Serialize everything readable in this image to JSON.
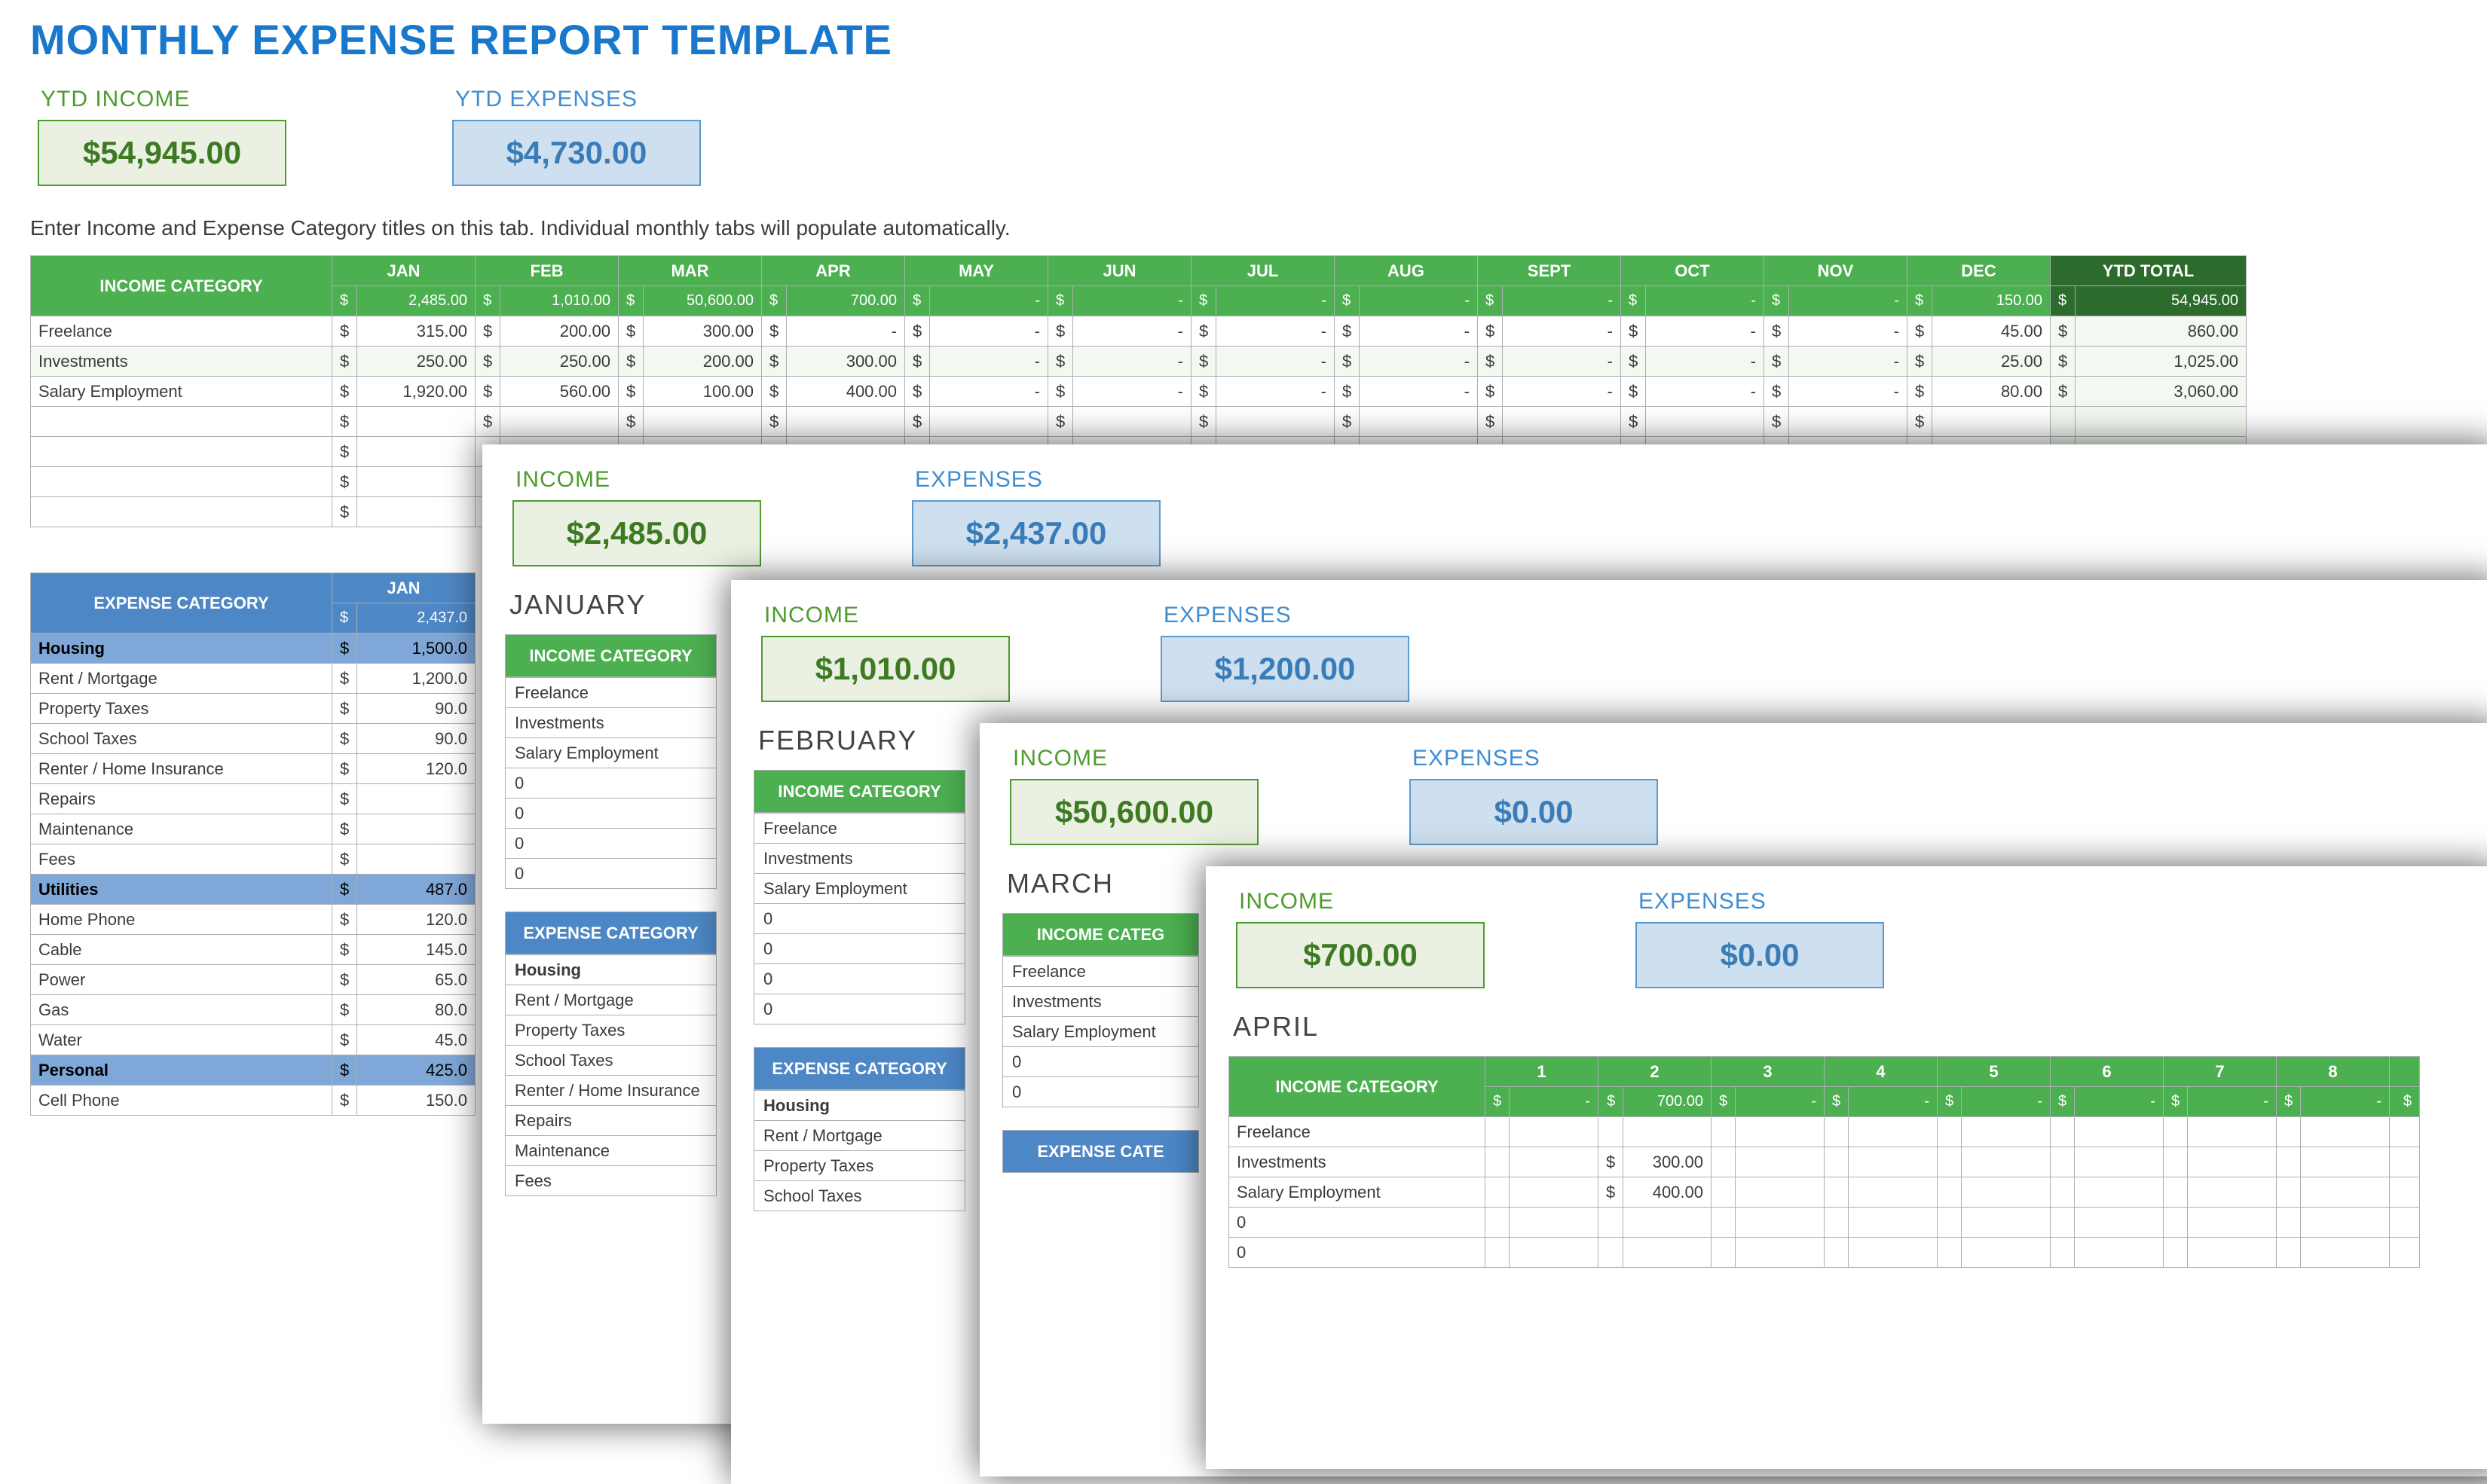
{
  "title": "MONTHLY EXPENSE REPORT TEMPLATE",
  "ytd": {
    "income_label": "YTD INCOME",
    "income_value": "$54,945.00",
    "expense_label": "YTD EXPENSES",
    "expense_value": "$4,730.00"
  },
  "instruction": "Enter Income and Expense Category titles on this tab.  Individual monthly tabs will populate automatically.",
  "income_header": "INCOME CATEGORY",
  "ytd_total_header": "YTD TOTAL",
  "months": [
    "JAN",
    "FEB",
    "MAR",
    "APR",
    "MAY",
    "JUN",
    "JUL",
    "AUG",
    "SEPT",
    "OCT",
    "NOV",
    "DEC"
  ],
  "income_totals_row": [
    "2,485.00",
    "1,010.00",
    "50,600.00",
    "700.00",
    "-",
    "-",
    "-",
    "-",
    "-",
    "-",
    "-",
    "150.00"
  ],
  "ytd_total": "54,945.00",
  "income_rows": [
    {
      "name": "Freelance",
      "vals": [
        "315.00",
        "200.00",
        "300.00",
        "-",
        "-",
        "-",
        "-",
        "-",
        "-",
        "-",
        "-",
        "45.00"
      ],
      "ytd": "860.00"
    },
    {
      "name": "Investments",
      "vals": [
        "250.00",
        "250.00",
        "200.00",
        "300.00",
        "-",
        "-",
        "-",
        "-",
        "-",
        "-",
        "-",
        "25.00"
      ],
      "ytd": "1,025.00"
    },
    {
      "name": "Salary Employment",
      "vals": [
        "1,920.00",
        "560.00",
        "100.00",
        "400.00",
        "-",
        "-",
        "-",
        "-",
        "-",
        "-",
        "-",
        "80.00"
      ],
      "ytd": "3,060.00"
    }
  ],
  "empty_income_rows": 4,
  "expense_header": "EXPENSE CATEGORY",
  "jan_header": "JAN",
  "jan_exp_total": "2,437.0",
  "expense_rows": [
    {
      "type": "cat",
      "name": "Housing",
      "val": "1,500.0"
    },
    {
      "type": "item",
      "name": "Rent / Mortgage",
      "val": "1,200.0"
    },
    {
      "type": "item",
      "name": "Property Taxes",
      "val": "90.0"
    },
    {
      "type": "item",
      "name": "School Taxes",
      "val": "90.0"
    },
    {
      "type": "item",
      "name": "Renter / Home Insurance",
      "val": "120.0"
    },
    {
      "type": "item",
      "name": "Repairs",
      "val": ""
    },
    {
      "type": "item",
      "name": "Maintenance",
      "val": ""
    },
    {
      "type": "item",
      "name": "Fees",
      "val": ""
    },
    {
      "type": "cat",
      "name": "Utilities",
      "val": "487.0"
    },
    {
      "type": "item",
      "name": "Home Phone",
      "val": "120.0"
    },
    {
      "type": "item",
      "name": "Cable",
      "val": "145.0"
    },
    {
      "type": "item",
      "name": "Power",
      "val": "65.0"
    },
    {
      "type": "item",
      "name": "Gas",
      "val": "80.0"
    },
    {
      "type": "item",
      "name": "Water",
      "val": "45.0"
    },
    {
      "type": "cat",
      "name": "Personal",
      "val": "425.0"
    },
    {
      "type": "item",
      "name": "Cell Phone",
      "val": "150.0"
    }
  ],
  "cards": {
    "jan": {
      "income_label": "INCOME",
      "income_value": "$2,485.00",
      "expense_label": "EXPENSES",
      "expense_value": "$2,437.00",
      "month": "JANUARY",
      "income_hdr": "INCOME CATEGORY",
      "income_items": [
        "Freelance",
        "Investments",
        "Salary Employment",
        "0",
        "0",
        "0",
        "0"
      ],
      "expense_hdr": "EXPENSE CATEGORY",
      "expense_groups": [
        {
          "cat": "Housing",
          "items": [
            "Rent / Mortgage",
            "Property Taxes",
            "School Taxes",
            "Renter / Home Insurance",
            "Repairs",
            "Maintenance",
            "Fees"
          ]
        }
      ]
    },
    "feb": {
      "income_label": "INCOME",
      "income_value": "$1,010.00",
      "expense_label": "EXPENSES",
      "expense_value": "$1,200.00",
      "month": "FEBRUARY",
      "income_hdr": "INCOME CATEGORY",
      "income_items": [
        "Freelance",
        "Investments",
        "Salary Employment",
        "0",
        "0",
        "0",
        "0"
      ],
      "expense_hdr": "EXPENSE CATEGORY",
      "expense_groups": [
        {
          "cat": "Housing",
          "items": [
            "Rent / Mortgage",
            "Property Taxes",
            "School Taxes"
          ]
        }
      ]
    },
    "mar": {
      "income_label": "INCOME",
      "income_value": "$50,600.00",
      "expense_label": "EXPENSES",
      "expense_value": "$0.00",
      "month": "MARCH",
      "income_hdr": "INCOME CATEG",
      "income_items": [
        "Freelance",
        "Investments",
        "Salary Employment",
        "0",
        "0"
      ],
      "expense_hdr": "EXPENSE CATE"
    },
    "apr": {
      "income_label": "INCOME",
      "income_value": "$700.00",
      "expense_label": "EXPENSES",
      "expense_value": "$0.00",
      "month": "APRIL",
      "income_hdr": "INCOME CATEGORY",
      "days": [
        "1",
        "2",
        "3",
        "4",
        "5",
        "6",
        "7",
        "8"
      ],
      "day_sub": [
        "-",
        "700.00",
        "-",
        "-",
        "-",
        "-",
        "-",
        "-"
      ],
      "rows": [
        {
          "name": "Freelance",
          "cells": [
            "",
            "",
            "",
            "",
            "",
            "",
            "",
            ""
          ]
        },
        {
          "name": "Investments",
          "cells": [
            "",
            "300.00",
            "",
            "",
            "",
            "",
            "",
            ""
          ]
        },
        {
          "name": "Salary Employment",
          "cells": [
            "",
            "400.00",
            "",
            "",
            "",
            "",
            "",
            ""
          ]
        },
        {
          "name": "0",
          "cells": [
            "",
            "",
            "",
            "",
            "",
            "",
            "",
            ""
          ]
        },
        {
          "name": "0",
          "cells": [
            "",
            "",
            "",
            "",
            "",
            "",
            "",
            ""
          ]
        }
      ]
    }
  }
}
